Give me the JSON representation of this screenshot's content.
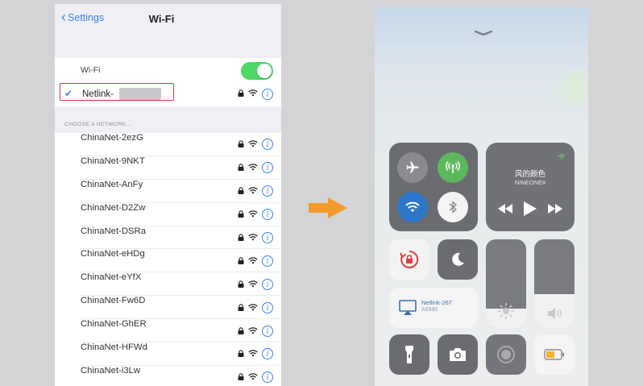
{
  "settings": {
    "back_label": "Settings",
    "title": "Wi-Fi",
    "wifi_label": "Wi-Fi",
    "wifi_enabled": true,
    "connected_network": "Netlink-",
    "section_header": "CHOOSE A NETWORK...",
    "networks": [
      "ChinaNet-2ezG",
      "ChinaNet-9NKT",
      "ChinaNet-AnFy",
      "ChinaNet-D2Zw",
      "ChinaNet-DSRa",
      "ChinaNet-eHDg",
      "ChinaNet-eYfX",
      "ChinaNet-Fw6D",
      "ChinaNet-GhER",
      "ChinaNet-HFWd",
      "ChinaNet-i3Lw"
    ]
  },
  "control_center": {
    "now_playing": {
      "song": "风的颜色",
      "artist": "NINEONE#"
    },
    "screen_mirroring": {
      "line1": "Netlink-267",
      "line2": "A6980"
    },
    "brightness_level": 0.22,
    "volume_level": 0.38
  },
  "colors": {
    "toggle_on": "#4cd964",
    "ios_blue": "#3b82f6",
    "highlight_red": "#d43a3a",
    "arrow_orange": "#f29b2a",
    "cellular_green": "#5cb85c",
    "wifi_blue": "#2f78c9"
  },
  "icons": {
    "lock": "lock-icon",
    "wifi": "wifi-signal-icon",
    "info": "info-icon",
    "airplane": "airplane-icon",
    "cellular": "cellular-icon",
    "bluetooth": "bluetooth-icon",
    "rotation_lock": "rotation-lock-icon",
    "do_not_disturb": "moon-icon",
    "flashlight": "flashlight-icon",
    "camera": "camera-icon",
    "record": "screen-record-icon",
    "battery": "low-power-icon"
  }
}
